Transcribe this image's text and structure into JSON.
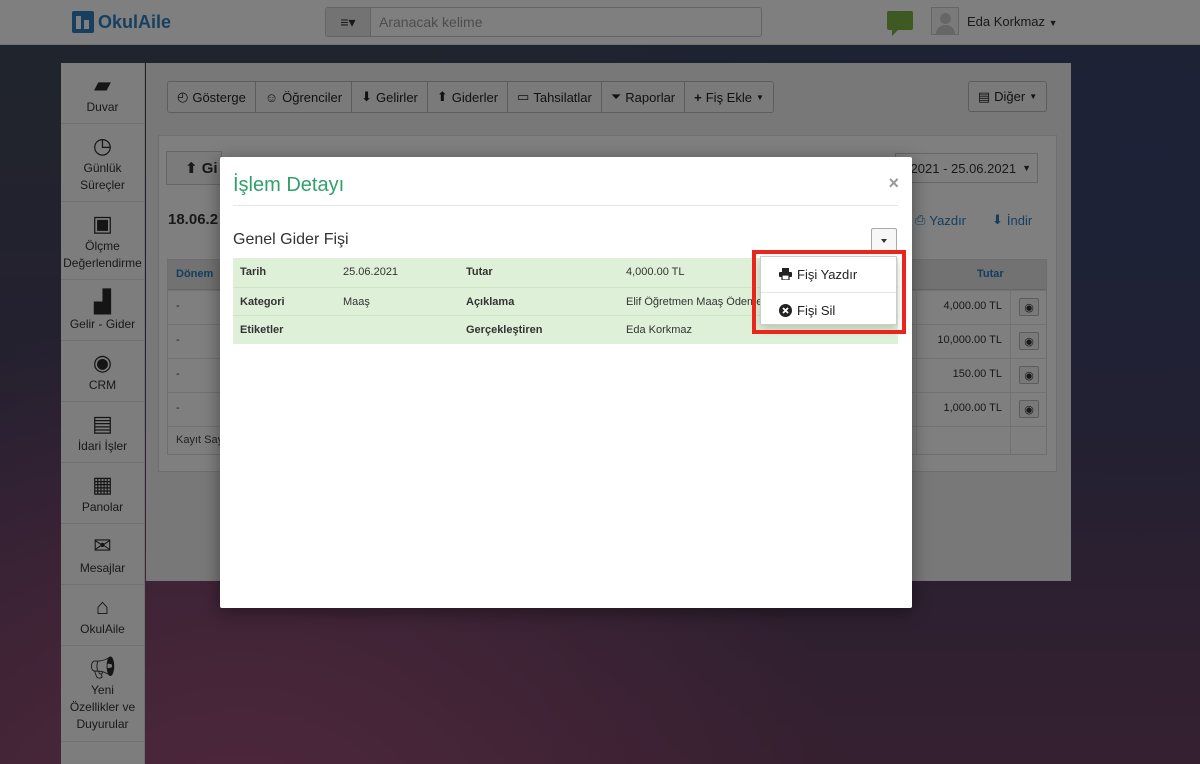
{
  "header": {
    "logo_text": "OkulAile",
    "search_placeholder": "Aranacak kelime",
    "user_name": "Eda Korkmaz"
  },
  "sidebar": {
    "items": [
      {
        "label": "Duvar",
        "icon": "wall-icon"
      },
      {
        "label": "Günlük",
        "label2": "Süreçler",
        "icon": "clock-icon"
      },
      {
        "label": "Ölçme",
        "label2": "Değerlendirme",
        "icon": "monitor-icon"
      },
      {
        "label": "Gelir - Gider",
        "icon": "bar-chart-icon"
      },
      {
        "label": "CRM",
        "icon": "chat-bubble-icon"
      },
      {
        "label": "İdari İşler",
        "icon": "briefcase-icon"
      },
      {
        "label": "Panolar",
        "icon": "calendar-grid-icon"
      },
      {
        "label": "Mesajlar",
        "icon": "envelope-icon"
      },
      {
        "label": "OkulAile",
        "icon": "okulaile-icon"
      },
      {
        "label": "Yeni",
        "label2": "Özellikler ve",
        "label3": "Duyurular",
        "icon": "megaphone-icon"
      }
    ]
  },
  "toolbar": {
    "buttons": [
      "Gösterge",
      "Öğrenciler",
      "Gelirler",
      "Giderler",
      "Tahsilatlar",
      "Raporlar",
      "Fiş Ekle"
    ],
    "other_label": "Diğer"
  },
  "panel": {
    "heading_partial": "Gi",
    "date_range": ".2021 - 25.06.2021",
    "date_prefix": "18.06.2",
    "print_label": "Yazdır",
    "download_label": "İndir"
  },
  "table": {
    "col_donem": "Dönem",
    "col_tutar": "Tutar",
    "rows": [
      {
        "donem": "-",
        "amount": "4,000.00 TL"
      },
      {
        "donem": "-",
        "amount": "10,000.00 TL"
      },
      {
        "donem": "-",
        "amount": "150.00 TL"
      },
      {
        "donem": "-",
        "amount": "1,000.00 TL"
      }
    ],
    "footer_partial": "Kayıt Say"
  },
  "modal": {
    "title": "İşlem Detayı",
    "close": "×",
    "receipt_title": "Genel Gider Fişi",
    "rows": [
      {
        "l1": "Tarih",
        "v1": "25.06.2021",
        "l2": "Tutar",
        "v2": "4,000.00 TL"
      },
      {
        "l1": "Kategori",
        "v1": "Maaş",
        "l2": "Açıklama",
        "v2": "Elif Öğretmen Maaş Ödemesi"
      },
      {
        "l1": "Etiketler",
        "v1": "",
        "l2": "Gerçekleştiren",
        "v2": "Eda Korkmaz"
      }
    ]
  },
  "dropdown": {
    "print_receipt": "Fişi Yazdır",
    "delete_receipt": "Fişi Sil"
  },
  "colors": {
    "brand": "#2d7fc1",
    "modal_title": "#2fa06b",
    "highlight": "#e8261e",
    "info_bg": "#dff0d8"
  }
}
